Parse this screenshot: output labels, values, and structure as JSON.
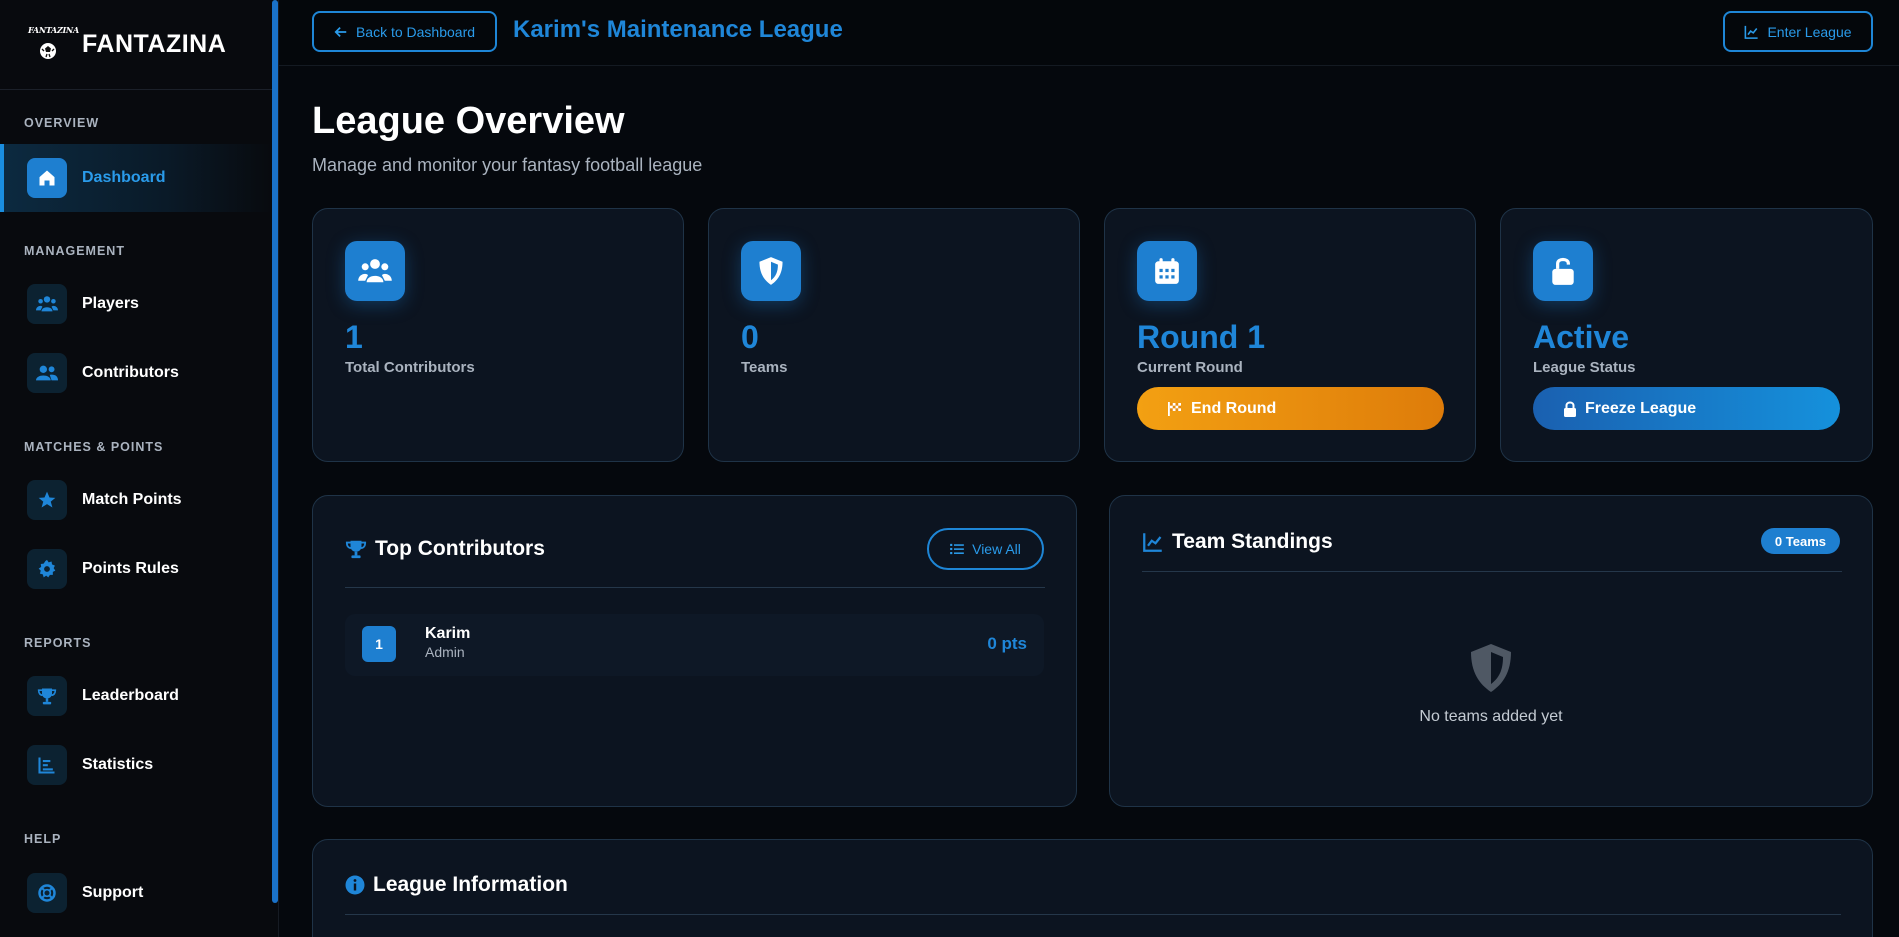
{
  "brand": {
    "logo_text": "FANTAZINA",
    "name": "FANTAZINA"
  },
  "sidebar": {
    "sections": {
      "overview": "OVERVIEW",
      "management": "MANAGEMENT",
      "matches": "MATCHES & POINTS",
      "reports": "REPORTS",
      "help": "HELP"
    },
    "items": [
      {
        "label": "Dashboard",
        "icon": "home-icon",
        "active": true
      },
      {
        "label": "Players",
        "icon": "users-icon"
      },
      {
        "label": "Contributors",
        "icon": "user-group-icon"
      },
      {
        "label": "Match Points",
        "icon": "star-icon"
      },
      {
        "label": "Points Rules",
        "icon": "gear-icon"
      },
      {
        "label": "Leaderboard",
        "icon": "trophy-icon"
      },
      {
        "label": "Statistics",
        "icon": "bar-chart-icon"
      },
      {
        "label": "Support",
        "icon": "lifebuoy-icon"
      }
    ]
  },
  "topbar": {
    "back_label": "Back to Dashboard",
    "league_name": "Karim's Maintenance League",
    "enter_label": "Enter League"
  },
  "page": {
    "title": "League Overview",
    "subtitle": "Manage and monitor your fantasy football league"
  },
  "stats": [
    {
      "value": "1",
      "label": "Total Contributors",
      "icon": "users-icon"
    },
    {
      "value": "0",
      "label": "Teams",
      "icon": "shield-icon"
    },
    {
      "value": "Round 1",
      "label": "Current Round",
      "icon": "calendar-icon",
      "action": "End Round"
    },
    {
      "value": "Active",
      "label": "League Status",
      "icon": "unlock-icon",
      "action": "Freeze League"
    }
  ],
  "top_contributors": {
    "title": "Top Contributors",
    "view_all": "View All",
    "rows": [
      {
        "rank": "1",
        "name": "Karim",
        "role": "Admin",
        "points": "0 pts"
      }
    ]
  },
  "team_standings": {
    "title": "Team Standings",
    "badge": "0 Teams",
    "empty": "No teams added yet"
  },
  "league_info": {
    "title": "League Information"
  },
  "colors": {
    "accent": "#1e7fd0",
    "accent_text": "#1f86d8",
    "orange": "#f3a012",
    "card_bg": "#0c1420",
    "page_bg": "#05080d"
  }
}
